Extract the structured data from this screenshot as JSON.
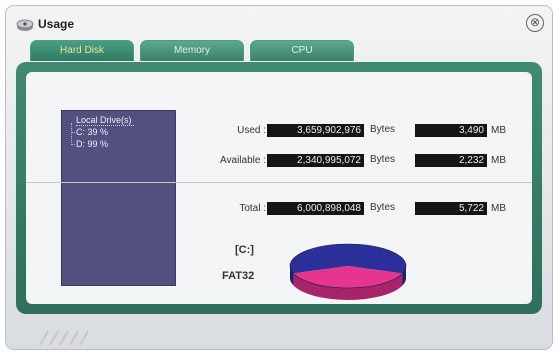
{
  "window": {
    "title": "Usage",
    "close_symbol": "⊗"
  },
  "tabs": [
    {
      "label": "Hard Disk",
      "active": true
    },
    {
      "label": "Memory",
      "active": false
    },
    {
      "label": "CPU",
      "active": false
    }
  ],
  "tree": {
    "root": "Local Drive(s)",
    "items": [
      "C:  39 %",
      "D:  99 %"
    ]
  },
  "stats": {
    "used": {
      "label": "Used :",
      "bytes": "3,659,902,976",
      "bytes_unit": "Bytes",
      "mb": "3,490",
      "mb_unit": "MB"
    },
    "available": {
      "label": "Available :",
      "bytes": "2,340,995,072",
      "bytes_unit": "Bytes",
      "mb": "2,232",
      "mb_unit": "MB"
    },
    "total": {
      "label": "Total :",
      "bytes": "6,000,898,048",
      "bytes_unit": "Bytes",
      "mb": "5,722",
      "mb_unit": "MB"
    }
  },
  "drive": {
    "letter": "[C:]",
    "filesystem": "FAT32"
  },
  "pie": {
    "used_fraction": 0.61,
    "used_color": "#2b2f9a",
    "free_color": "#e6358f"
  },
  "colors": {
    "panel": "#3b8670",
    "tree_bg": "#52507e",
    "active_tab_text": "#e9e39a"
  }
}
